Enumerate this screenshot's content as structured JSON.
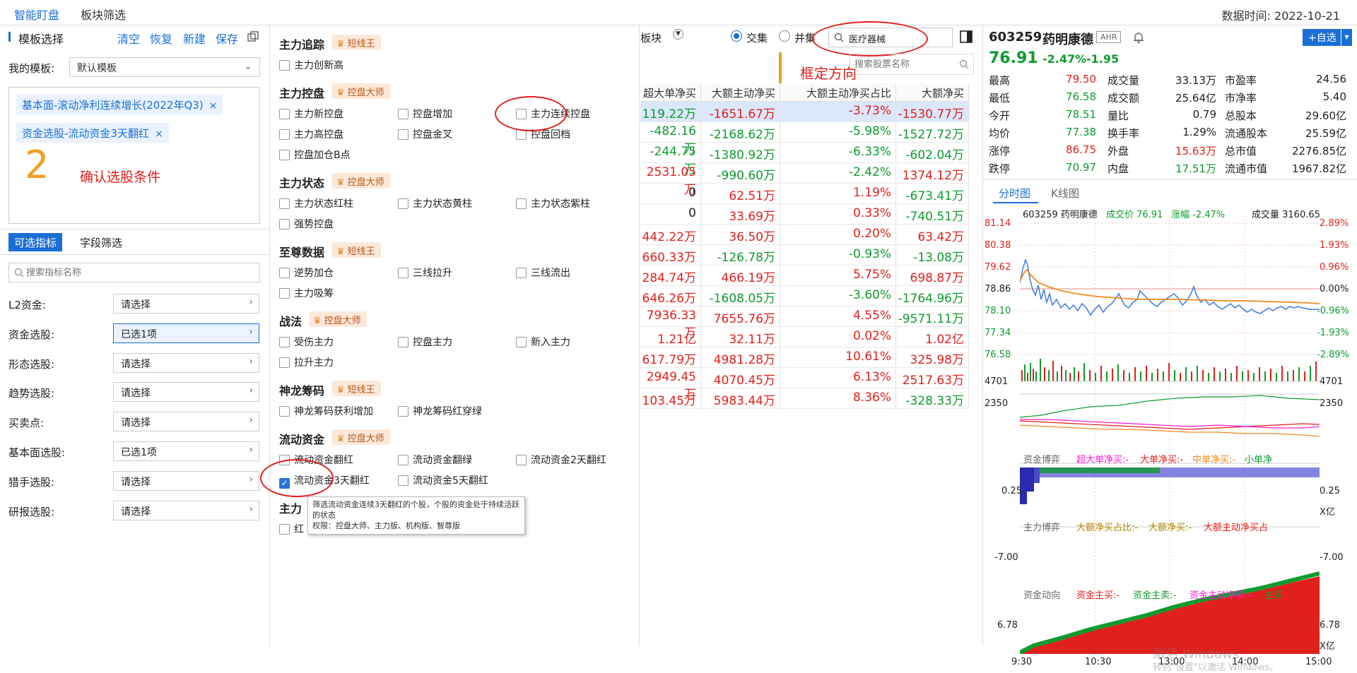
{
  "topbar": {
    "tabs": [
      "智能盯盘",
      "板块筛选"
    ],
    "datetime": "数据时间: 2022-10-21"
  },
  "left": {
    "template_title": "模板选择",
    "actions": [
      "清空",
      "恢复",
      "新建",
      "保存"
    ],
    "my_template_label": "我的模板:",
    "my_template_value": "默认模板",
    "conditions": [
      "基本面-滚动净利连续增长(2022年Q3)",
      "资金选股-流动资金3天翻红"
    ],
    "annotation_number": "2",
    "annotation_text": "确认选股条件",
    "tabs": [
      "可选指标",
      "字段筛选"
    ],
    "search_placeholder": "搜索指标名称",
    "filters": [
      {
        "label": "L2资金:",
        "value": "请选择"
      },
      {
        "label": "资金选股:",
        "value": "已选1项"
      },
      {
        "label": "形态选股:",
        "value": "请选择"
      },
      {
        "label": "趋势选股:",
        "value": "请选择"
      },
      {
        "label": "买卖点:",
        "value": "请选择"
      },
      {
        "label": "基本面选股:",
        "value": "已选1项"
      },
      {
        "label": "猎手选股:",
        "value": "请选择"
      },
      {
        "label": "研报选股:",
        "value": "请选择"
      }
    ]
  },
  "middle": {
    "sections": [
      {
        "title": "主力追踪",
        "badge": "短线王",
        "items": [
          "主力创新高"
        ]
      },
      {
        "title": "主力控盘",
        "badge": "控盘大师",
        "items": [
          "主力新控盘",
          "控盘增加",
          "主力连续控盘",
          "主力高控盘",
          "控盘金叉",
          "控盘回档",
          "控盘加仓B点"
        ]
      },
      {
        "title": "主力状态",
        "badge": "控盘大师",
        "items": [
          "主力状态红柱",
          "主力状态黄柱",
          "主力状态紫柱",
          "强势控盘"
        ]
      },
      {
        "title": "至尊数据",
        "badge": "短线王",
        "items": [
          "逆势加仓",
          "三线拉升",
          "三线流出",
          "主力吸筹"
        ]
      },
      {
        "title": "战法",
        "badge": "控盘大师",
        "items": [
          "受伤主力",
          "控盘主力",
          "新入主力",
          "拉升主力"
        ]
      },
      {
        "title": "神龙筹码",
        "badge": "短线王",
        "items": [
          "神龙筹码获利增加",
          "神龙筹码红穿绿"
        ]
      },
      {
        "title": "流动资金",
        "badge": "控盘大师",
        "items": [
          "流动资金翻红",
          "流动资金翻绿",
          "流动资金2天翻红",
          "流动资金3天翻红",
          "流动资金5天翻红"
        ]
      },
      {
        "title": "主力",
        "badge": "",
        "items": [
          "红"
        ]
      }
    ],
    "tooltip_line1": "筛选流动资金连续3天翻红的个股，个股的资金处于持续活跃的状态",
    "tooltip_line2": "权限：控盘大师、主力版、机构版、智尊版"
  },
  "table": {
    "sector_label": "板块",
    "radio_intersect": "交集",
    "radio_union": "并集",
    "sector_search_value": "医疗器械",
    "stock_search_placeholder": "搜索股票名称",
    "annotation": "框定方向",
    "headers": [
      "超大单净买",
      "大额主动净买",
      "大额主动净买占比",
      "大额净买"
    ],
    "rows": [
      [
        "119.22万",
        "-1651.67万",
        "-3.73%",
        "-1530.77万"
      ],
      [
        "-482.16万",
        "-2168.62万",
        "-5.98%",
        "-1527.72万"
      ],
      [
        "-244.75万",
        "-1380.92万",
        "-6.33%",
        "-602.04万"
      ],
      [
        "2531.05万",
        "-990.60万",
        "-2.42%",
        "1374.12万"
      ],
      [
        "0",
        "62.51万",
        "1.19%",
        "-673.41万"
      ],
      [
        "0",
        "33.69万",
        "0.33%",
        "-740.51万"
      ],
      [
        "442.22万",
        "36.50万",
        "0.20%",
        "63.42万"
      ],
      [
        "660.33万",
        "-126.78万",
        "-0.93%",
        "-13.08万"
      ],
      [
        "284.74万",
        "466.19万",
        "5.75%",
        "698.87万"
      ],
      [
        "646.26万",
        "-1608.05万",
        "-3.60%",
        "-1764.96万"
      ],
      [
        "7936.33万",
        "7655.76万",
        "4.55%",
        "-9571.11万"
      ],
      [
        "1.21亿",
        "32.11万",
        "0.02%",
        "1.02亿"
      ],
      [
        "617.79万",
        "4981.28万",
        "10.61%",
        "325.98万"
      ],
      [
        "2949.45万",
        "4070.45万",
        "6.13%",
        "2517.63万"
      ],
      [
        "103.45万",
        "5983.44万",
        "8.36%",
        "-328.33万"
      ]
    ]
  },
  "right": {
    "code": "603259",
    "name": "药明康德",
    "tag": "AHR",
    "add_btn": "+自选",
    "price": "76.91",
    "change_pct": "-2.47%",
    "change": "-1.95",
    "quote": [
      [
        "最高",
        "79.50",
        "成交量",
        "33.13万",
        "市盈率",
        "24.56"
      ],
      [
        "最低",
        "76.58",
        "成交额",
        "25.64亿",
        "市净率",
        "5.40"
      ],
      [
        "今开",
        "78.51",
        "量比",
        "0.79",
        "总股本",
        "29.60亿"
      ],
      [
        "均价",
        "77.38",
        "换手率",
        "1.29%",
        "流通股本",
        "25.59亿"
      ],
      [
        "涨停",
        "86.75",
        "外盘",
        "15.63万",
        "总市值",
        "2276.85亿"
      ],
      [
        "跌停",
        "70.97",
        "内盘",
        "17.51万",
        "流通市值",
        "1967.82亿"
      ]
    ],
    "chart_tabs": [
      "分时图",
      "K线图"
    ],
    "chart_header": [
      "603259 药明康德",
      "成交价 76.91",
      "涨幅 -2.47%",
      "成交量 3160.65"
    ],
    "price_ticks": [
      "81.14",
      "80.38",
      "79.62",
      "78.86",
      "78.10",
      "77.34",
      "76.58"
    ],
    "pct_ticks": [
      "2.89%",
      "1.93%",
      "0.96%",
      "0.00%",
      "-0.96%",
      "-1.93%",
      "-2.89%"
    ],
    "vol_ticks": [
      "4701",
      "2350"
    ],
    "ind1": {
      "name": "资金博弈",
      "labels": [
        "超大单净买:-",
        "大单净买:-",
        "中单净买:-",
        "小单净"
      ],
      "tick": "0.25",
      "unit": "X亿"
    },
    "ind2": {
      "name": "主力博弈",
      "labels": [
        "大额净买占比:-",
        "大额净买:-",
        "大额主动净买占"
      ],
      "tick": "-7.00"
    },
    "ind3": {
      "name": "资金动向",
      "labels": [
        "资金主买:-",
        "资金主卖:-",
        "资金主动净买:-",
        "主买"
      ],
      "tick": "6.78",
      "unit": "X亿"
    },
    "time_ticks": [
      "9:30",
      "10:30",
      "13:00",
      "14:00",
      "15:00"
    ],
    "watermark1": "激活 Windows",
    "watermark2": "转到\"设置\"以激活 Windows。"
  }
}
